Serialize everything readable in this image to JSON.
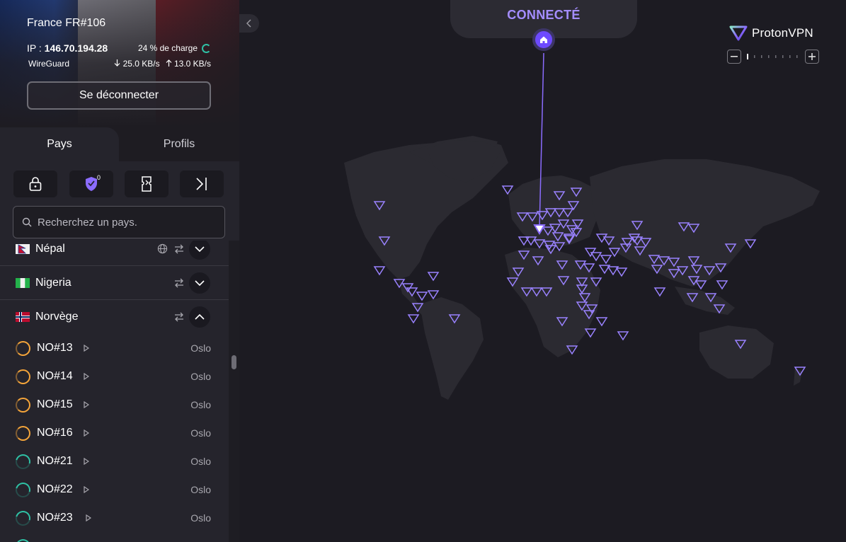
{
  "connection": {
    "server": "France FR#106",
    "ip_label": "IP : ",
    "ip": "146.70.194.28",
    "load": "24 % de charge",
    "protocol": "WireGuard",
    "download": "25.0 KB/s",
    "upload": "13.0 KB/s",
    "disconnect_label": "Se déconnecter"
  },
  "tabs": {
    "countries": "Pays",
    "profiles": "Profils"
  },
  "features": {
    "netshield_badge": "0"
  },
  "search": {
    "placeholder": "Recherchez un pays."
  },
  "countries": [
    {
      "name": "Népal",
      "expanded": false
    },
    {
      "name": "Nigeria",
      "expanded": false
    },
    {
      "name": "Norvège",
      "expanded": true
    }
  ],
  "servers": [
    {
      "name": "NO#13",
      "city": "Oslo",
      "load_color": "orange"
    },
    {
      "name": "NO#14",
      "city": "Oslo",
      "load_color": "orange"
    },
    {
      "name": "NO#15",
      "city": "Oslo",
      "load_color": "orange"
    },
    {
      "name": "NO#16",
      "city": "Oslo",
      "load_color": "orange"
    },
    {
      "name": "NO#21",
      "city": "Oslo",
      "load_color": "green"
    },
    {
      "name": "NO#22",
      "city": "Oslo",
      "load_color": "green"
    },
    {
      "name": "NO#23",
      "city": "Oslo",
      "load_color": "green"
    }
  ],
  "map": {
    "status": "CONNECTÉ"
  },
  "brand": {
    "name": "ProtonVPN"
  },
  "colors": {
    "accent": "#6d4aff",
    "status_text": "#a48dff",
    "load_orange": "#f5a53a",
    "load_green": "#2fc0a5"
  }
}
